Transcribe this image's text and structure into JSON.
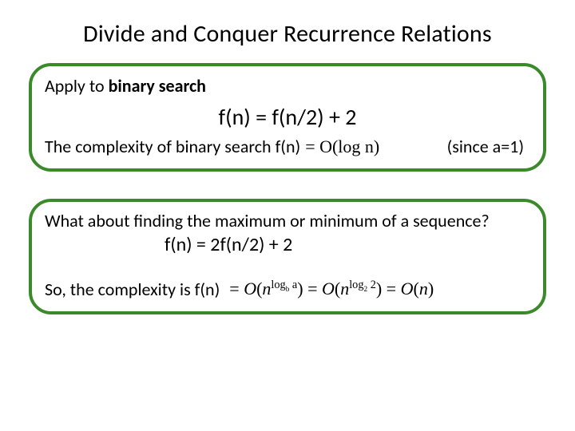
{
  "title": "Divide and Conquer Recurrence Relations",
  "box1": {
    "apply_prefix": "Apply to ",
    "apply_bold": "binary search",
    "formula": "f(n) = f(n/2) + 2",
    "complexity_prefix": "The complexity of binary search   f(n)",
    "complexity_math": "= O(log n)",
    "since": "(since a=1)"
  },
  "box2": {
    "question": "What about finding the maximum or minimum of a sequence?",
    "formula": "f(n) = 2f(n/2) + 2",
    "so_prefix": "So, the complexity is f(n)"
  }
}
